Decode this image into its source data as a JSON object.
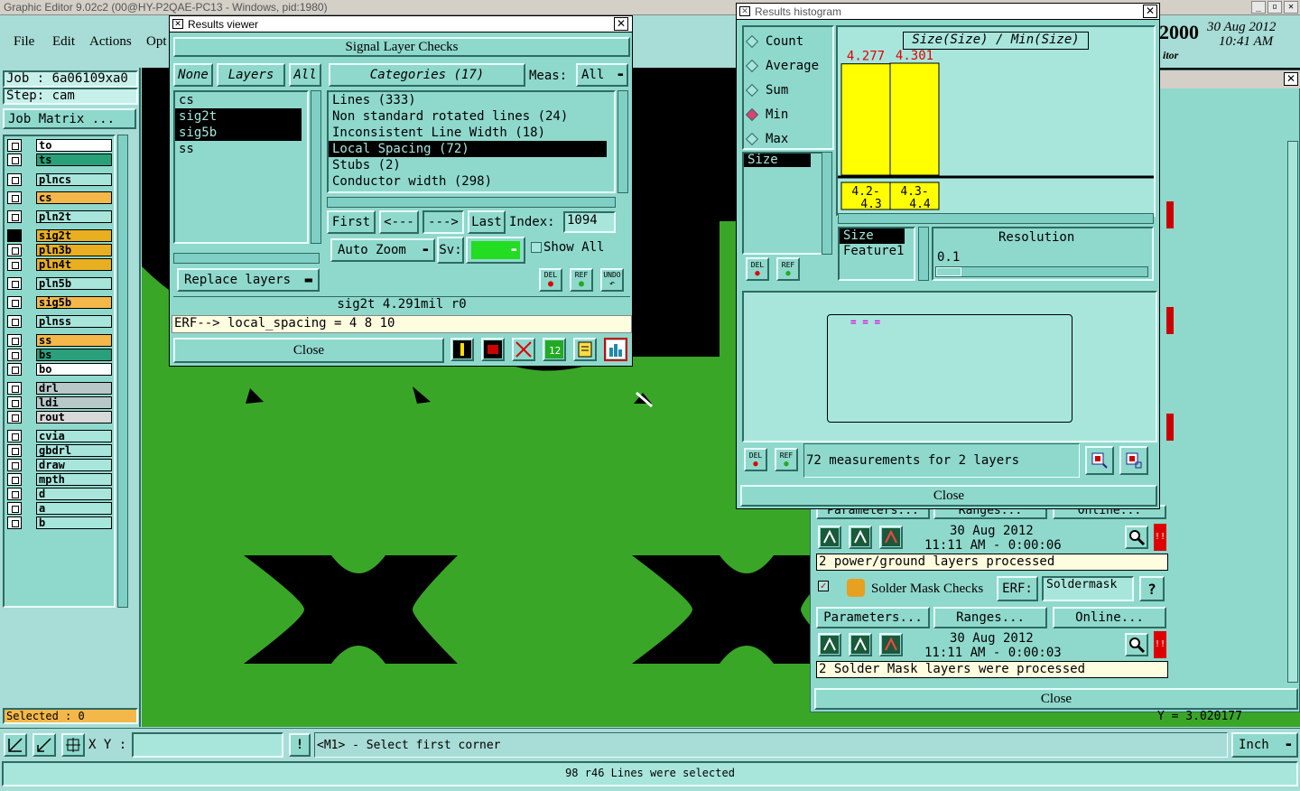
{
  "app": {
    "title": "Graphic Editor 9.02c2 (00@HY-P2QAE-PC13 - Windows, pid:1980)",
    "menu": [
      "File",
      "Edit",
      "Actions",
      "Opt"
    ]
  },
  "left": {
    "job": "Job : 6a06109xa0",
    "step": "Step: cam",
    "job_matrix": "Job Matrix ...",
    "selected": "Selected : 0",
    "layers": [
      {
        "name": "to",
        "color": "#ffffff"
      },
      {
        "name": "ts",
        "color": "#2aa07a"
      },
      {
        "name": "plncs",
        "color": "#a8e6dc"
      },
      {
        "name": "cs",
        "color": "#f4b84a"
      },
      {
        "name": "pln2t",
        "color": "#a8e6dc"
      },
      {
        "name": "sig2t",
        "color": "#e8b020"
      },
      {
        "name": "pln3b",
        "color": "#e8b020"
      },
      {
        "name": "pln4t",
        "color": "#e8b020"
      },
      {
        "name": "pln5b",
        "color": "#a8e6dc"
      },
      {
        "name": "sig5b",
        "color": "#f4b84a"
      },
      {
        "name": "plnss",
        "color": "#a8e6dc"
      },
      {
        "name": "ss",
        "color": "#f4b84a"
      },
      {
        "name": "bs",
        "color": "#2aa07a"
      },
      {
        "name": "bo",
        "color": "#ffffff"
      },
      {
        "name": "drl",
        "color": "#b8c8c8"
      },
      {
        "name": "ldi",
        "color": "#b8c8c8"
      },
      {
        "name": "rout",
        "color": "#d8d8d8"
      },
      {
        "name": "cvia",
        "color": "#a8e6dc"
      },
      {
        "name": "gbdrl",
        "color": "#a8e6dc"
      },
      {
        "name": "draw",
        "color": "#a8e6dc"
      },
      {
        "name": "mpth",
        "color": "#a8e6dc"
      },
      {
        "name": "d",
        "color": "#a8e6dc"
      },
      {
        "name": "a",
        "color": "#a8e6dc"
      },
      {
        "name": "b",
        "color": "#a8e6dc"
      }
    ]
  },
  "header_right": {
    "year": "2000",
    "date": "30 Aug 2012",
    "time": "10:41 AM",
    "sub": "itor"
  },
  "results_viewer": {
    "title": "Results viewer",
    "header": "Signal Layer Checks",
    "none_btn": "None",
    "layers_btn": "Layers",
    "all_btn": "All",
    "categories": "Categories (17)",
    "meas_label": "Meas:",
    "meas_value": "All",
    "layers": [
      "cs",
      "sig2t",
      "sig5b",
      "ss"
    ],
    "cats": [
      "Lines (333)",
      "Non standard rotated lines (24)",
      "Inconsistent Line Width (18)",
      "Local Spacing (72)",
      "Stubs (2)",
      "Conductor width (298)"
    ],
    "first": "First",
    "prev": "<---",
    "next": "--->",
    "last": "Last",
    "index_label": "Index:",
    "index_value": "1094",
    "auto_zoom": "Auto Zoom",
    "sv": "Sv:",
    "show_all": "Show All",
    "replace": "Replace layers",
    "status": "sig2t 4.291mil  r0",
    "erf": "ERF--> local_spacing = 4 8 10",
    "close": "Close",
    "del": "DEL",
    "ref": "REF",
    "undo": "UNDO"
  },
  "histogram": {
    "title": "Results histogram",
    "modes": [
      "Count",
      "Average",
      "Sum",
      "Min",
      "Max"
    ],
    "selected_mode": "Min",
    "field": "Size",
    "chart_title": "Size(Size) / Min(Size)",
    "chart_data": {
      "type": "bar",
      "categories": [
        "4.2-\n4.3",
        "4.3-\n4.4"
      ],
      "values": [
        4.277,
        4.301
      ],
      "value_labels": [
        "4.277",
        "4.301"
      ]
    },
    "bin_labels": [
      "4.2-",
      "4.3",
      "4.3-",
      "4.4"
    ],
    "list2": [
      "Size",
      "Feature1"
    ],
    "resolution_label": "Resolution",
    "resolution_value": "0.1",
    "measurements": "72 measurements for 2 layers",
    "close": "Close",
    "del": "DEL",
    "ref": "REF"
  },
  "checks": {
    "params": "Parameters...",
    "ranges": "Ranges...",
    "online": "Online...",
    "date1": "30 Aug 2012",
    "time1": "11:11 AM - 0:00:06",
    "msg1": "2 power/ground layers processed",
    "solder": "Solder Mask Checks",
    "erf": "ERF:",
    "erf_value": "Soldermask",
    "help": "?",
    "date2": "30 Aug 2012",
    "time2": "11:11 AM - 0:00:03",
    "msg2": "2 Solder Mask layers were processed",
    "close": "Close",
    "partial": "Y = 3.020177"
  },
  "bottom": {
    "xy": "X Y :",
    "info": "<M1> - Select first corner",
    "unit": "Inch",
    "status": "98 r46 Lines were selected"
  }
}
